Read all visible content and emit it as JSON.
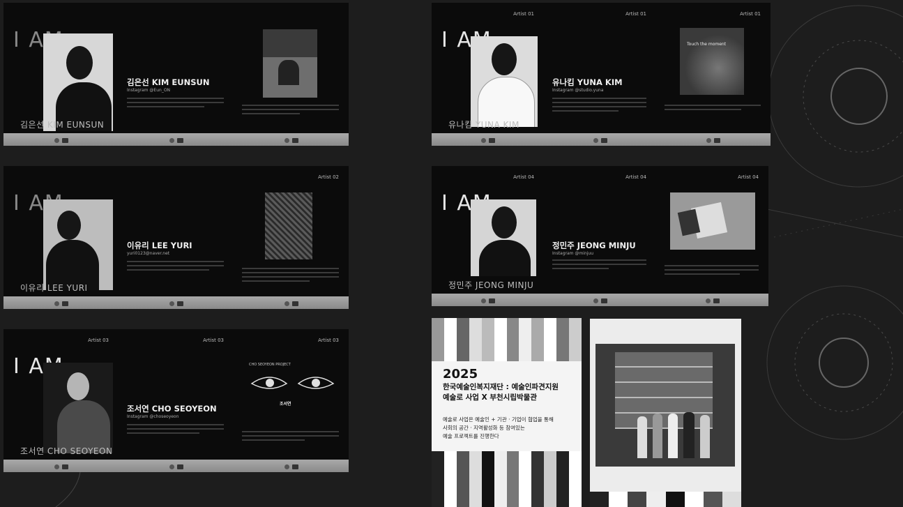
{
  "colors": {
    "background": "#1d1d1d",
    "card": "#0b0b0b",
    "bar": "#9a9a9a",
    "poster": "#f4f4f4"
  },
  "panels": [
    {
      "intro": {
        "heading": "I AM",
        "caption": "김은선 KIM EUNSUN"
      },
      "profile": {
        "name": "김은선 KIM EUNSUN",
        "handle": "Instagram @Eun_ON"
      }
    },
    {
      "intro": {
        "heading": "I AM",
        "caption": "이유리 LEE YURI"
      },
      "profile": {
        "name": "이유리 LEE YURI",
        "handle": "yuri0123@naver.net"
      },
      "artwork_tag": "Artist 02"
    },
    {
      "intro": {
        "heading": "I AM",
        "caption": "조서연 CHO SEOYEON",
        "tag": "Artist 03"
      },
      "profile": {
        "name": "조서연 CHO SEOYEON",
        "handle": "Instagram @choseoyeon",
        "tag": "Artist 03"
      },
      "artwork_tag": "Artist 03",
      "artwork_title": "조서연",
      "artwork_header": "CHO SEOYEON PROJECT"
    },
    {
      "intro": {
        "heading": "I AM",
        "caption": "유나킴 YUNA KIM",
        "tag": "Artist 01"
      },
      "profile": {
        "name": "유나킴 YUNA KIM",
        "handle": "Instagram @studio.yuna",
        "tag": "Artist 01"
      },
      "artwork_tag": "Artist 01",
      "artwork_title": "Touch the moment"
    },
    {
      "intro": {
        "heading": "I AM",
        "caption": "정민주 JEONG MINJU",
        "tag": "Artist 04"
      },
      "profile": {
        "name": "정민주 JEONG MINJU",
        "handle": "Instagram @minjuu",
        "tag": "Artist 04"
      },
      "artwork_tag": "Artist 04"
    }
  ],
  "poster": {
    "year": "2025",
    "title_line1": "한국예술인복지재단 : 예술인파견지원",
    "title_line2": "예술로 사업 X 부천시립박물관",
    "desc_line1": "예술로 사업은 예술인 + 기관 · 기업이 협업을 통해",
    "desc_line2": "사회의 공간 · 지역활성화 등 참여있는",
    "desc_line3": "예술 프로젝트를 진행한다"
  }
}
